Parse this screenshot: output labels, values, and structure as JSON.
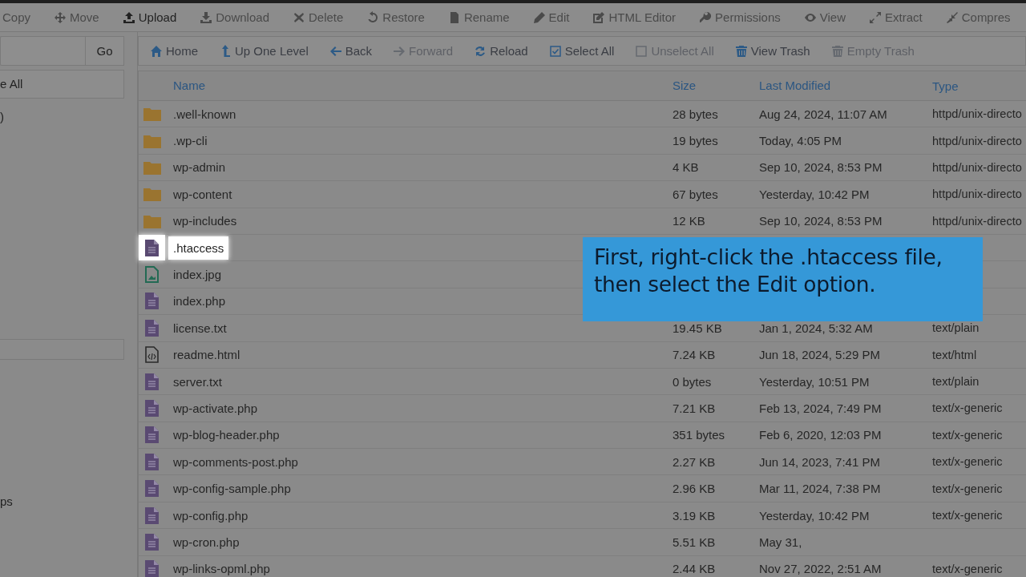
{
  "toolbar": [
    {
      "label": "Copy",
      "disabled": true
    },
    {
      "label": "Move",
      "disabled": true
    },
    {
      "label": "Upload",
      "disabled": false
    },
    {
      "label": "Download",
      "disabled": true
    },
    {
      "label": "Delete",
      "disabled": true
    },
    {
      "label": "Restore",
      "disabled": true
    },
    {
      "label": "Rename",
      "disabled": true
    },
    {
      "label": "Edit",
      "disabled": true
    },
    {
      "label": "HTML Editor",
      "disabled": true
    },
    {
      "label": "Permissions",
      "disabled": true
    },
    {
      "label": "View",
      "disabled": true
    },
    {
      "label": "Extract",
      "disabled": true
    },
    {
      "label": "Compres",
      "disabled": true
    }
  ],
  "sidebar": {
    "go_button": "Go",
    "collapse_button": "e All",
    "tree_fragment": ")",
    "bottom_fragment": "ps"
  },
  "nav": [
    {
      "label": "Home",
      "disabled": false
    },
    {
      "label": "Up One Level",
      "disabled": false
    },
    {
      "label": "Back",
      "disabled": false
    },
    {
      "label": "Forward",
      "disabled": true
    },
    {
      "label": "Reload",
      "disabled": false
    },
    {
      "label": "Select All",
      "disabled": false
    },
    {
      "label": "Unselect All",
      "disabled": true
    },
    {
      "label": "View Trash",
      "disabled": false
    },
    {
      "label": "Empty Trash",
      "disabled": true
    }
  ],
  "table": {
    "columns": [
      "Name",
      "Size",
      "Last Modified",
      "Type"
    ],
    "rows": [
      {
        "kind": "folder",
        "name": ".well-known",
        "size": "28 bytes",
        "modified": "Aug 24, 2024, 11:07 AM",
        "type": "httpd/unix-directo",
        "highlighted": false
      },
      {
        "kind": "folder",
        "name": ".wp-cli",
        "size": "19 bytes",
        "modified": "Today, 4:05 PM",
        "type": "httpd/unix-directo",
        "highlighted": false
      },
      {
        "kind": "folder",
        "name": "wp-admin",
        "size": "4 KB",
        "modified": "Sep 10, 2024, 8:53 PM",
        "type": "httpd/unix-directo",
        "highlighted": false
      },
      {
        "kind": "folder",
        "name": "wp-content",
        "size": "67 bytes",
        "modified": "Yesterday, 10:42 PM",
        "type": "httpd/unix-directo",
        "highlighted": false
      },
      {
        "kind": "folder",
        "name": "wp-includes",
        "size": "12 KB",
        "modified": "Sep 10, 2024, 8:53 PM",
        "type": "httpd/unix-directo",
        "highlighted": false
      },
      {
        "kind": "text",
        "name": ".htaccess",
        "highlighted": true
      },
      {
        "kind": "image",
        "name": "index.jpg",
        "highlighted": false
      },
      {
        "kind": "text",
        "name": "index.php",
        "highlighted": false
      },
      {
        "kind": "text",
        "name": "license.txt",
        "size": "19.45 KB",
        "modified": "Jan 1, 2024, 5:32 AM",
        "type": "text/plain",
        "highlighted": false
      },
      {
        "kind": "code",
        "name": "readme.html",
        "size": "7.24 KB",
        "modified": "Jun 18, 2024, 5:29 PM",
        "type": "text/html",
        "highlighted": false
      },
      {
        "kind": "text",
        "name": "server.txt",
        "size": "0 bytes",
        "modified": "Yesterday, 10:51 PM",
        "type": "text/plain",
        "highlighted": false
      },
      {
        "kind": "text",
        "name": "wp-activate.php",
        "size": "7.21 KB",
        "modified": "Feb 13, 2024, 7:49 PM",
        "type": "text/x-generic",
        "highlighted": false
      },
      {
        "kind": "text",
        "name": "wp-blog-header.php",
        "size": "351 bytes",
        "modified": "Feb 6, 2020, 12:03 PM",
        "type": "text/x-generic",
        "highlighted": false
      },
      {
        "kind": "text",
        "name": "wp-comments-post.php",
        "size": "2.27 KB",
        "modified": "Jun 14, 2023, 7:41 PM",
        "type": "text/x-generic",
        "highlighted": false
      },
      {
        "kind": "text",
        "name": "wp-config-sample.php",
        "size": "2.96 KB",
        "modified": "Mar 11, 2024, 7:38 PM",
        "type": "text/x-generic",
        "highlighted": false
      },
      {
        "kind": "text",
        "name": "wp-config.php",
        "size": "3.19 KB",
        "modified": "Yesterday, 10:42 PM",
        "type": "text/x-generic",
        "highlighted": false
      },
      {
        "kind": "text",
        "name": "wp-cron.php",
        "size": "5.51 KB",
        "modified": "May 31,",
        "highlighted": false
      },
      {
        "kind": "text",
        "name": "wp-links-opml.php",
        "size": "2.44 KB",
        "modified": "Nov 27, 2022, 2:51 AM",
        "type": "text/x-generic",
        "highlighted": false
      }
    ]
  },
  "caption": {
    "text": "First, right-click the .htaccess file, then select the Edit option."
  }
}
